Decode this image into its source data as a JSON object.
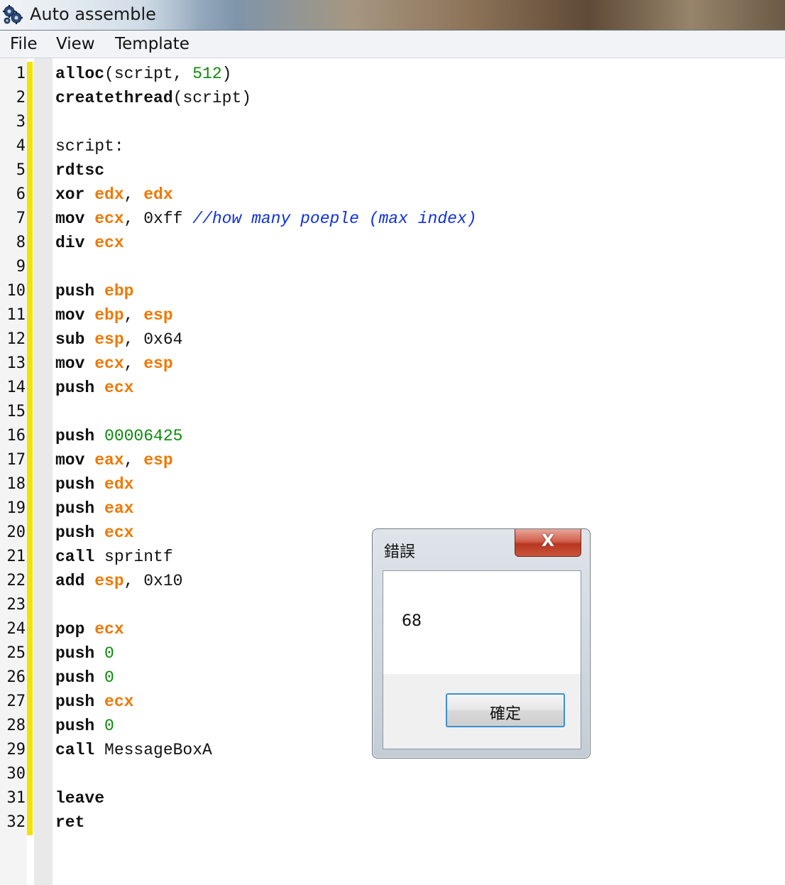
{
  "window": {
    "title": "Auto assemble",
    "icon": "gear-cluster-icon"
  },
  "menu": {
    "items": [
      "File",
      "View",
      "Template"
    ]
  },
  "editor": {
    "lines": [
      [
        {
          "t": "alloc",
          "c": "kw"
        },
        {
          "t": "(script, ",
          "c": ""
        },
        {
          "t": "512",
          "c": "num"
        },
        {
          "t": ")",
          "c": ""
        }
      ],
      [
        {
          "t": "createthread",
          "c": "kw"
        },
        {
          "t": "(script)",
          "c": ""
        }
      ],
      [],
      [
        {
          "t": "script:",
          "c": ""
        }
      ],
      [
        {
          "t": "rdtsc",
          "c": "kw"
        }
      ],
      [
        {
          "t": "xor ",
          "c": "kw"
        },
        {
          "t": "edx",
          "c": "reg"
        },
        {
          "t": ", ",
          "c": ""
        },
        {
          "t": "edx",
          "c": "reg"
        }
      ],
      [
        {
          "t": "mov ",
          "c": "kw"
        },
        {
          "t": "ecx",
          "c": "reg"
        },
        {
          "t": ", 0xff ",
          "c": ""
        },
        {
          "t": "//how many poeple (max index)",
          "c": "cmt"
        }
      ],
      [
        {
          "t": "div ",
          "c": "kw"
        },
        {
          "t": "ecx",
          "c": "reg"
        }
      ],
      [],
      [
        {
          "t": "push ",
          "c": "kw"
        },
        {
          "t": "ebp",
          "c": "reg"
        }
      ],
      [
        {
          "t": "mov ",
          "c": "kw"
        },
        {
          "t": "ebp",
          "c": "reg"
        },
        {
          "t": ", ",
          "c": ""
        },
        {
          "t": "esp",
          "c": "reg"
        }
      ],
      [
        {
          "t": "sub ",
          "c": "kw"
        },
        {
          "t": "esp",
          "c": "reg"
        },
        {
          "t": ", 0x64",
          "c": ""
        }
      ],
      [
        {
          "t": "mov ",
          "c": "kw"
        },
        {
          "t": "ecx",
          "c": "reg"
        },
        {
          "t": ", ",
          "c": ""
        },
        {
          "t": "esp",
          "c": "reg"
        }
      ],
      [
        {
          "t": "push ",
          "c": "kw"
        },
        {
          "t": "ecx",
          "c": "reg"
        }
      ],
      [],
      [
        {
          "t": "push ",
          "c": "kw"
        },
        {
          "t": "00006425",
          "c": "num"
        }
      ],
      [
        {
          "t": "mov ",
          "c": "kw"
        },
        {
          "t": "eax",
          "c": "reg"
        },
        {
          "t": ", ",
          "c": ""
        },
        {
          "t": "esp",
          "c": "reg"
        }
      ],
      [
        {
          "t": "push ",
          "c": "kw"
        },
        {
          "t": "edx",
          "c": "reg"
        }
      ],
      [
        {
          "t": "push ",
          "c": "kw"
        },
        {
          "t": "eax",
          "c": "reg"
        }
      ],
      [
        {
          "t": "push ",
          "c": "kw"
        },
        {
          "t": "ecx",
          "c": "reg"
        }
      ],
      [
        {
          "t": "call ",
          "c": "kw"
        },
        {
          "t": "sprintf",
          "c": ""
        }
      ],
      [
        {
          "t": "add ",
          "c": "kw"
        },
        {
          "t": "esp",
          "c": "reg"
        },
        {
          "t": ", 0x10",
          "c": ""
        }
      ],
      [],
      [
        {
          "t": "pop ",
          "c": "kw"
        },
        {
          "t": "ecx",
          "c": "reg"
        }
      ],
      [
        {
          "t": "push ",
          "c": "kw"
        },
        {
          "t": "0",
          "c": "num"
        }
      ],
      [
        {
          "t": "push ",
          "c": "kw"
        },
        {
          "t": "0",
          "c": "num"
        }
      ],
      [
        {
          "t": "push ",
          "c": "kw"
        },
        {
          "t": "ecx",
          "c": "reg"
        }
      ],
      [
        {
          "t": "push ",
          "c": "kw"
        },
        {
          "t": "0",
          "c": "num"
        }
      ],
      [
        {
          "t": "call ",
          "c": "kw"
        },
        {
          "t": "MessageBoxA",
          "c": ""
        }
      ],
      [],
      [
        {
          "t": "leave",
          "c": "kw"
        }
      ],
      [
        {
          "t": "ret",
          "c": "kw"
        }
      ]
    ]
  },
  "dialog": {
    "title": "錯誤",
    "close_label": "X",
    "message": "68",
    "ok_label": "確定"
  },
  "colors": {
    "register": "#f07800",
    "number": "#0a8a0a",
    "comment": "#1030e0",
    "change_marker": "#f2e400"
  }
}
